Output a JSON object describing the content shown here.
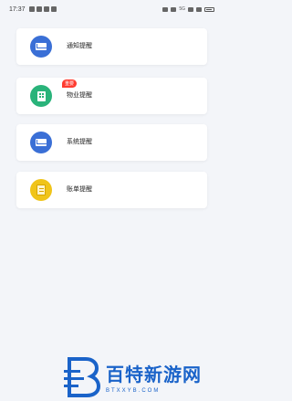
{
  "status_bar": {
    "time": "17:37",
    "network": "5G"
  },
  "cards": [
    {
      "label": "通知提醒",
      "icon": "envelope-icon",
      "icon_color": "#3a6fd6"
    },
    {
      "label": "物业提醒",
      "icon": "building-icon",
      "icon_color": "#29b37a",
      "badge": "重要"
    },
    {
      "label": "系统提醒",
      "icon": "envelope-icon",
      "icon_color": "#3a6fd6"
    },
    {
      "label": "账单提醒",
      "icon": "bill-icon",
      "icon_color": "#f0c419"
    }
  ],
  "watermark": {
    "title": "百特新游网",
    "subtitle": "BTXXYB.COM",
    "brand_color": "#1a63c9"
  }
}
